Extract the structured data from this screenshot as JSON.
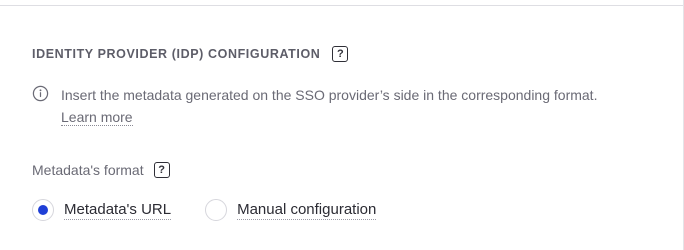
{
  "section": {
    "title": "IDENTITY PROVIDER (IDP) CONFIGURATION",
    "help_icon": "?"
  },
  "info": {
    "icon": "info-circle-icon",
    "text": "Insert the metadata generated on the SSO provider’s side in the corresponding format.",
    "learn_more": "Learn more"
  },
  "metadata_format": {
    "label": "Metadata's format",
    "help_icon": "?",
    "options": [
      {
        "label": "Metadata's URL",
        "selected": true
      },
      {
        "label": "Manual configuration",
        "selected": false
      }
    ]
  },
  "colors": {
    "accent": "#1f3fd6",
    "title": "#5d5d68",
    "muted_text": "#6a6a75",
    "text": "#2b2b33"
  }
}
